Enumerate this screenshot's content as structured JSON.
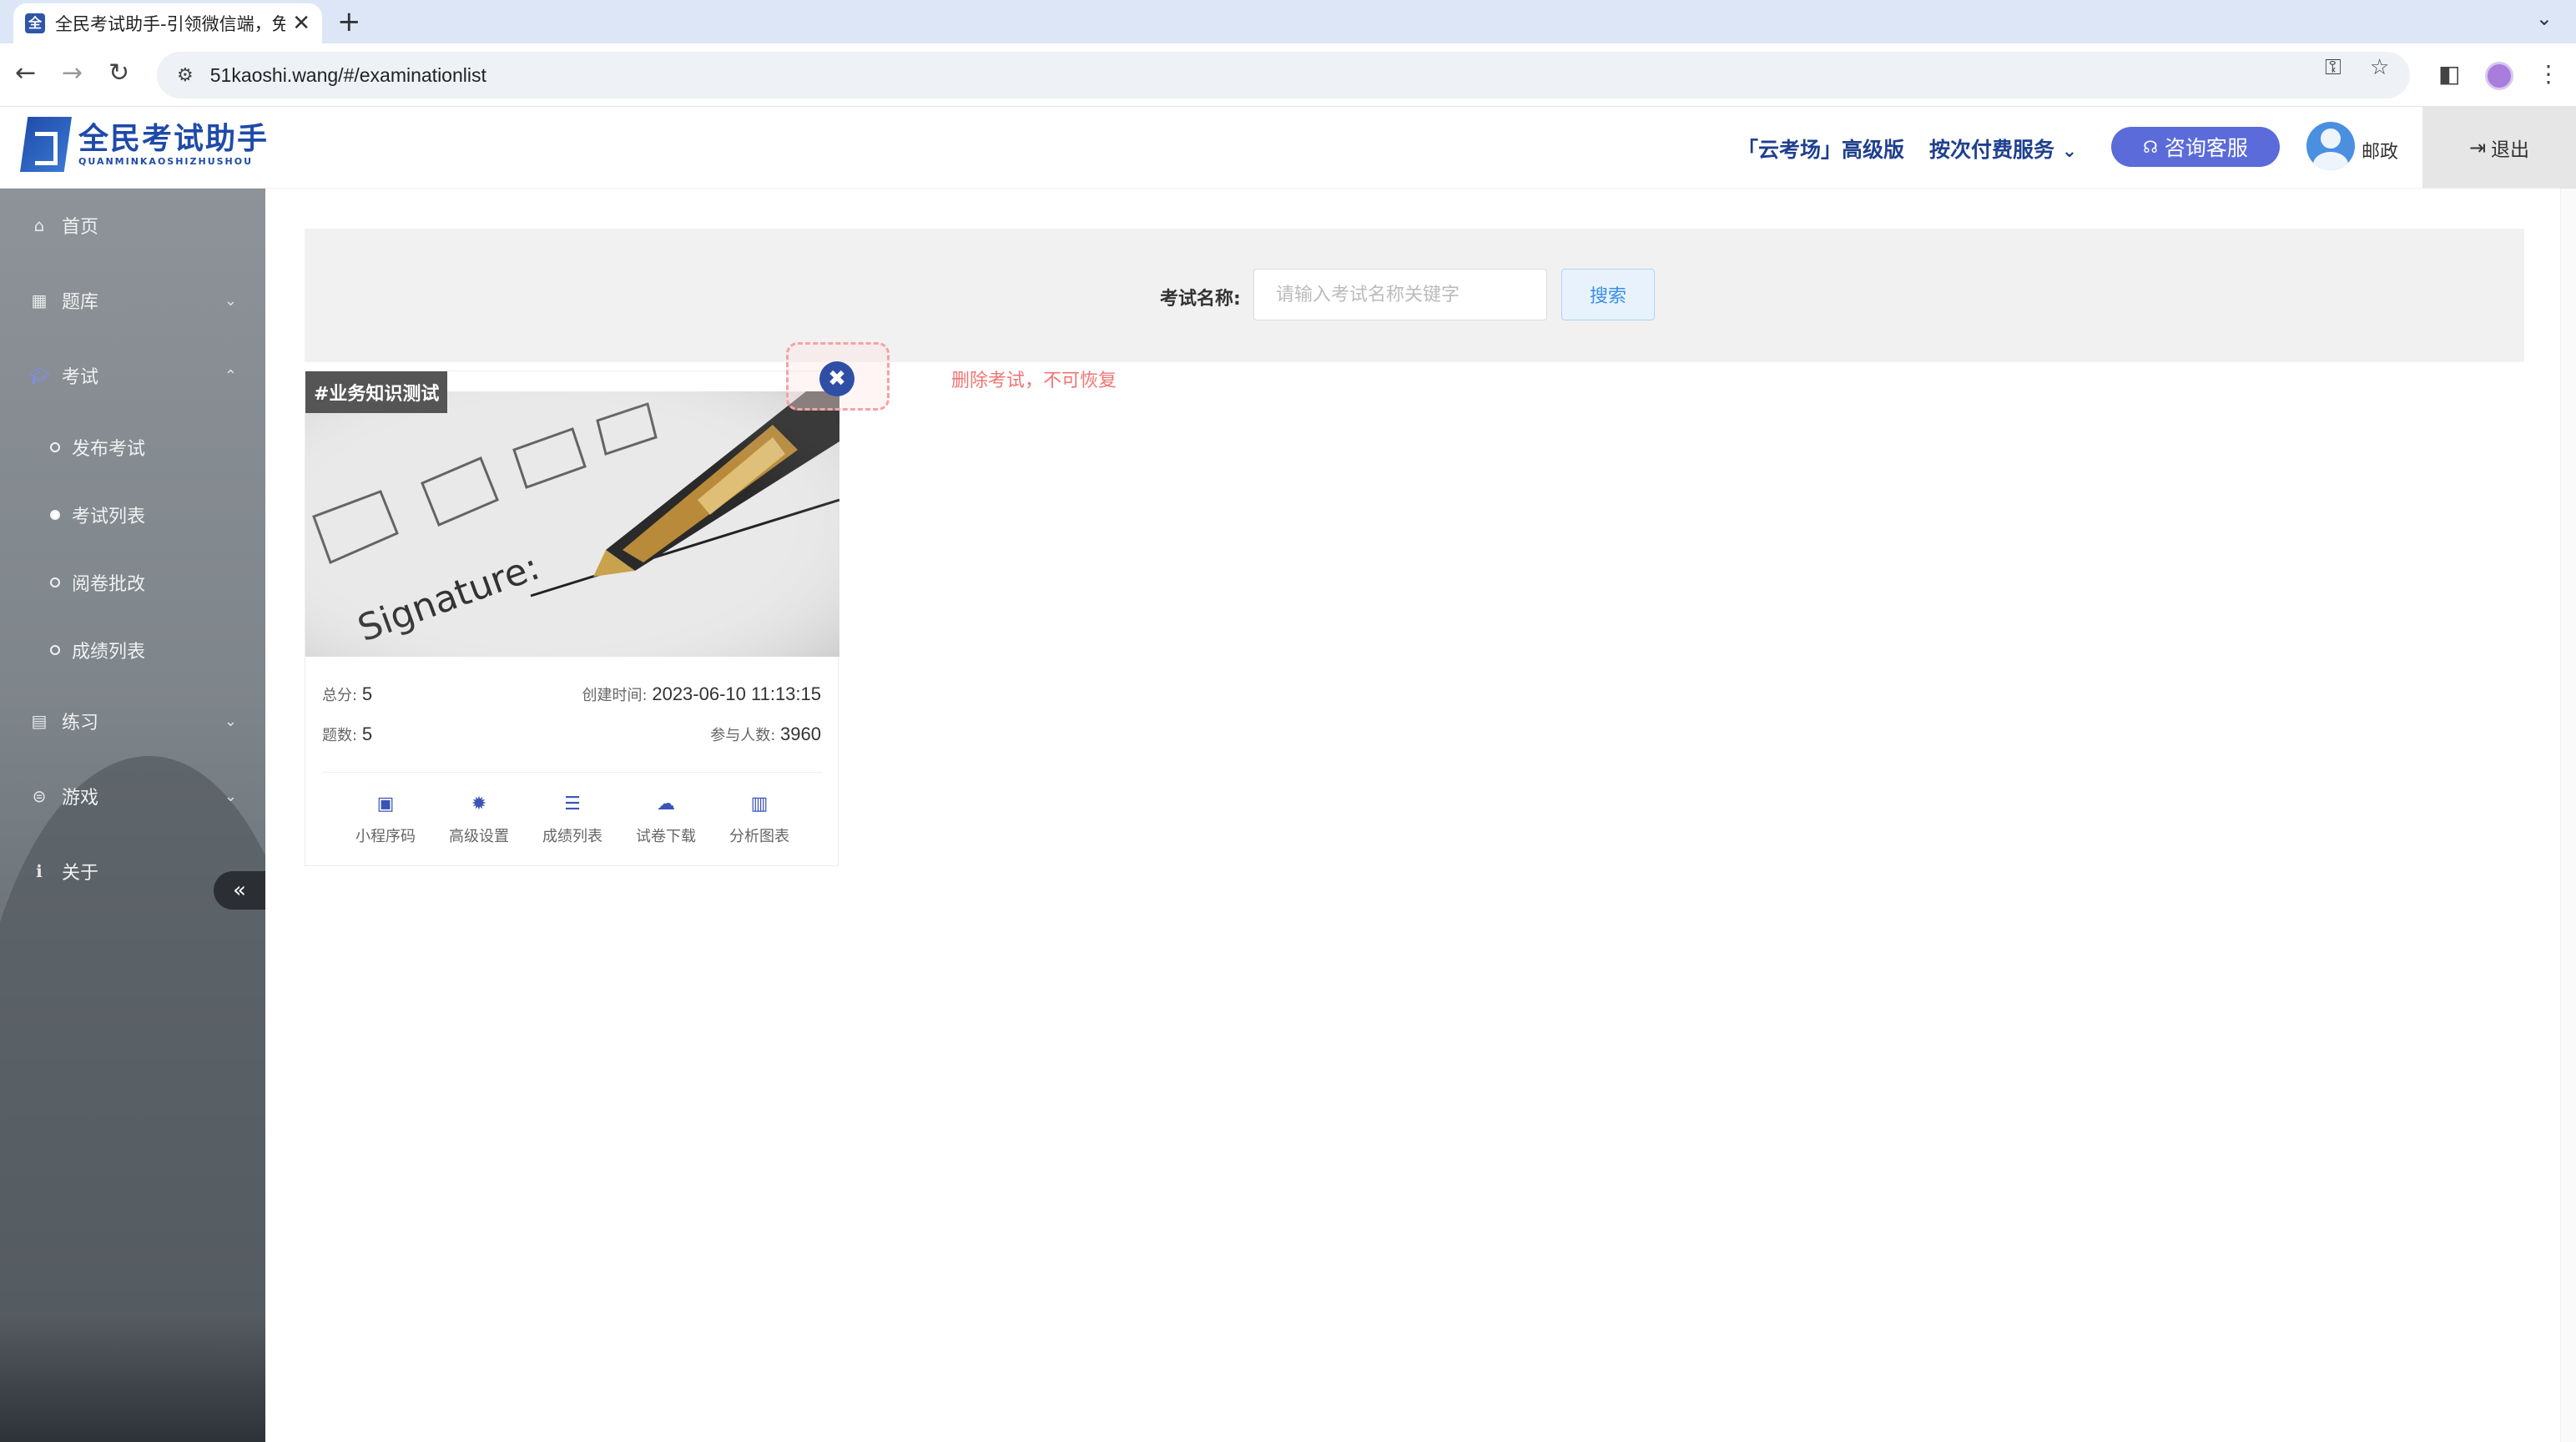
{
  "browser": {
    "tab_title": "全民考试助手-引领微信端，免",
    "tab_close": "✕",
    "new_tab": "+",
    "url": "51kaoshi.wang/#/examinationlist"
  },
  "header": {
    "logo_cn": "全民考试助手",
    "logo_en": "QUANMINKAOSHIZHUSHOU",
    "cloud_link": "「云考场」高级版",
    "pay_link": "按次付费服务",
    "consult_label": "咨询客服",
    "username": "邮政",
    "logout_label": "退出"
  },
  "sidebar": {
    "items": [
      {
        "label": "首页",
        "icon": "home-icon"
      },
      {
        "label": "题库",
        "icon": "grid-icon"
      },
      {
        "label": "考试",
        "icon": "graduation-cap-icon"
      },
      {
        "label": "练习",
        "icon": "book-icon"
      },
      {
        "label": "游戏",
        "icon": "gamepad-icon"
      },
      {
        "label": "关于",
        "icon": "info-icon"
      }
    ],
    "exam_sub": [
      {
        "label": "发布考试"
      },
      {
        "label": "考试列表"
      },
      {
        "label": "阅卷批改"
      },
      {
        "label": "成绩列表"
      }
    ],
    "collapse": "«"
  },
  "search": {
    "label": "考试名称:",
    "placeholder": "请输入考试名称关键字",
    "button": "搜索"
  },
  "exam_card": {
    "tag": "#业务知识测试",
    "image_text": "Signature:",
    "total_score_label": "总分:",
    "total_score": "5",
    "created_label": "创建时间:",
    "created": "2023-06-10 11:13:15",
    "questions_label": "题数:",
    "questions": "5",
    "participants_label": "参与人数:",
    "participants": "3960",
    "actions": [
      {
        "label": "小程序码",
        "icon": "qr-code-icon"
      },
      {
        "label": "高级设置",
        "icon": "gear-icon"
      },
      {
        "label": "成绩列表",
        "icon": "list-icon"
      },
      {
        "label": "试卷下载",
        "icon": "cloud-download-icon"
      },
      {
        "label": "分析图表",
        "icon": "bar-chart-icon"
      }
    ]
  },
  "delete": {
    "icon": "✖",
    "hint": "删除考试，不可恢复"
  },
  "colors": {
    "brand": "#1f4aa8",
    "accent": "#5b6bd9",
    "danger_hint": "#f07575"
  }
}
